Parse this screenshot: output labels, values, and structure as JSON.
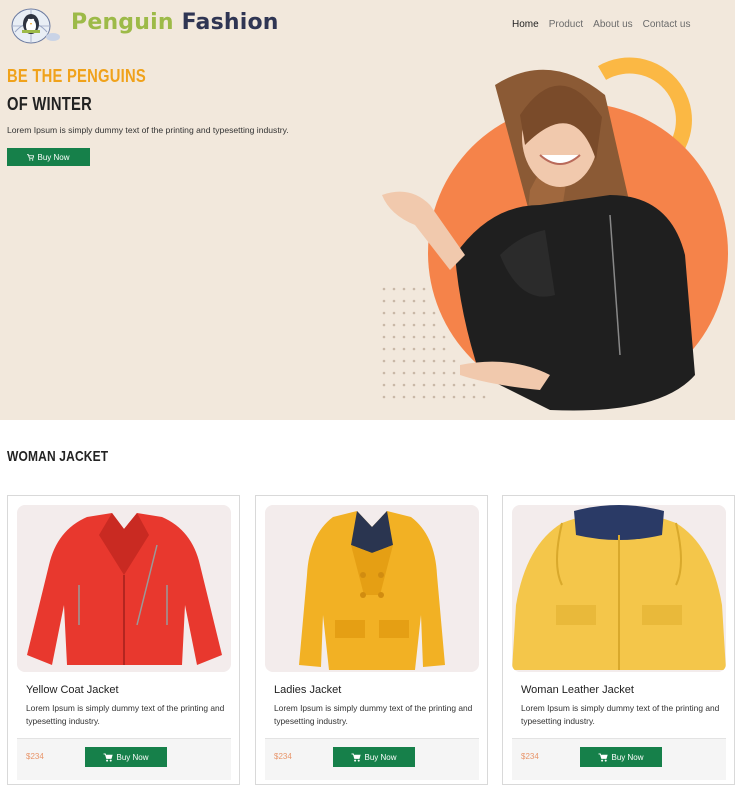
{
  "brand": {
    "word1": "Penguin",
    "word2": "Fashion"
  },
  "nav": {
    "items": [
      "Home",
      "Product",
      "About us",
      "Contact us"
    ]
  },
  "hero": {
    "headline_1": "BE THE PENGUINS",
    "headline_2": "OF WINTER",
    "subtext": "Lorem Ipsum is simply dummy text of the printing and typesetting industry.",
    "button_label": "Buy Now"
  },
  "section": {
    "title": "WOMAN JACKET"
  },
  "products": [
    {
      "name": "Yellow Coat Jacket",
      "desc": "Lorem Ipsum is simply dummy text of the printing and typesetting industry.",
      "price": "$234",
      "button_label": "Buy Now"
    },
    {
      "name": "Ladies Jacket",
      "desc": "Lorem Ipsum is simply dummy text of the printing and typesetting industry.",
      "price": "$234",
      "button_label": "Buy Now"
    },
    {
      "name": "Woman Leather Jacket",
      "desc": "Lorem Ipsum is simply dummy text of the printing and typesetting industry.",
      "price": "$234",
      "button_label": "Buy Now"
    }
  ],
  "colors": {
    "accent_green": "#16804a",
    "hero_bg": "#f2e8dc",
    "orange": "#f5834a",
    "yellow": "#f0a21b"
  }
}
